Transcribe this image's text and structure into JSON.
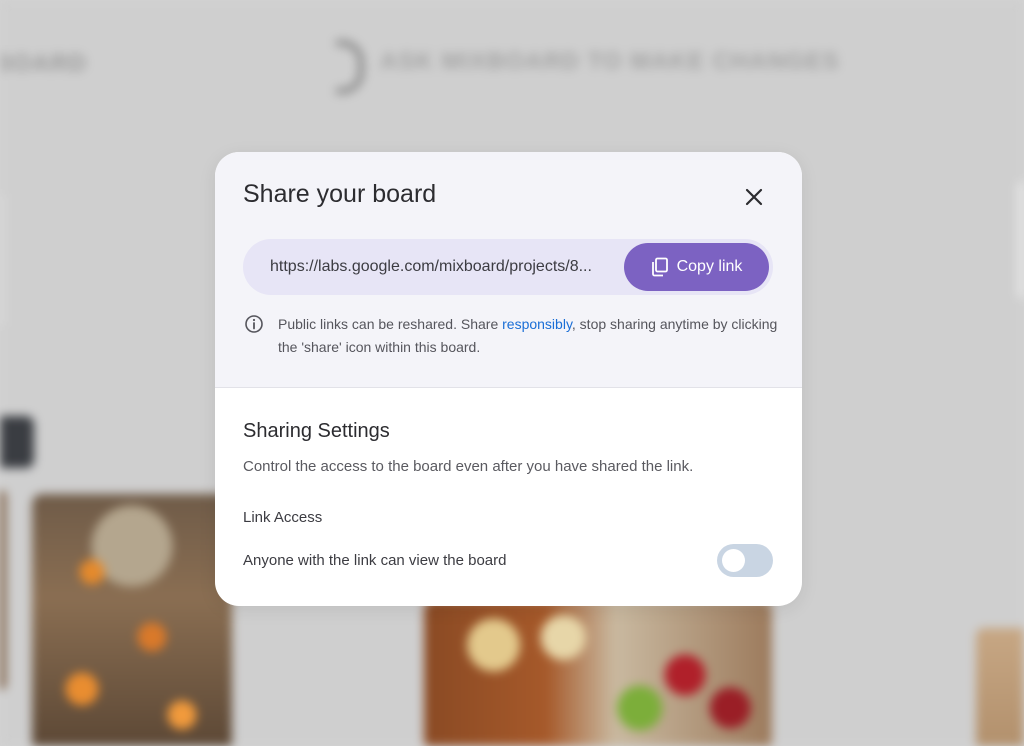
{
  "background": {
    "left_heading": "BOARD",
    "center_heading": "ASK MIXBOARD TO MAKE CHANGES"
  },
  "dialog": {
    "title": "Share your board",
    "link_url": "https://labs.google.com/mixboard/projects/8...",
    "copy_button_label": "Copy link",
    "info_text_before": "Public links can be reshared. Share ",
    "info_link_text": "responsibly",
    "info_text_after": ", stop sharing anytime by clicking the 'share' icon within this board.",
    "settings": {
      "title": "Sharing Settings",
      "description": "Control the access to the board even after you have shared the link.",
      "link_access_label": "Link Access",
      "anyone_can_view_label": "Anyone with the link can view the board",
      "anyone_can_view_enabled": false
    }
  },
  "colors": {
    "accent": "#7c62c2",
    "link_row_bg": "#e7e5f6",
    "info_link": "#1a6ed6",
    "toggle_off": "#c9d5e3"
  },
  "icons": {
    "close": "close-icon",
    "copy": "copy-icon",
    "info": "info-icon"
  }
}
